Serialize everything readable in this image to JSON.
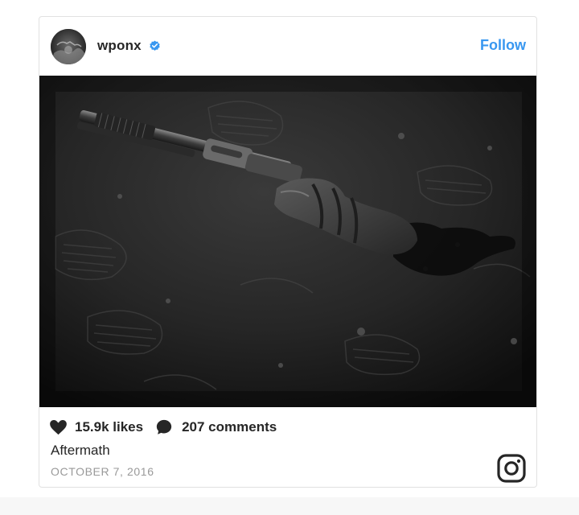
{
  "post": {
    "username": "wponx",
    "verified": true,
    "follow_label": "Follow",
    "likes": "15.9k likes",
    "comments": "207 comments",
    "caption": "Aftermath",
    "date": "OCTOBER 7, 2016"
  },
  "icons": {
    "verified": "verified-badge-icon",
    "like": "heart-icon",
    "comment": "comment-bubble-icon",
    "brand": "instagram-logo-icon"
  },
  "colors": {
    "accent": "#3897f0",
    "text": "#262626",
    "muted": "#999999",
    "border": "#e1e1e1"
  }
}
